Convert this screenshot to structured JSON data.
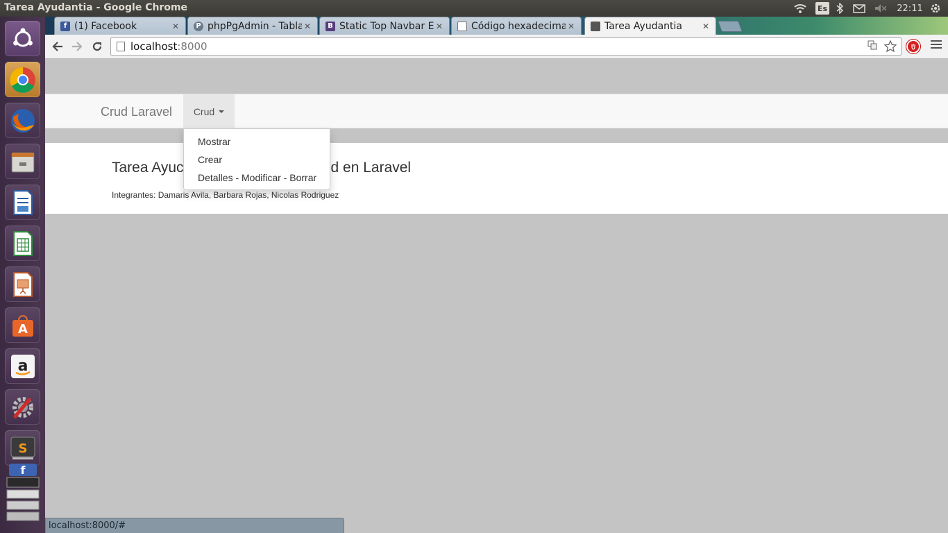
{
  "window": {
    "title": "Tarea Ayudantia - Google Chrome"
  },
  "panel": {
    "keyboard_layout": "Es",
    "clock": "22:11"
  },
  "launcher": {
    "items": [
      {
        "name": "ubuntu-dash-icon"
      },
      {
        "name": "chrome-icon"
      },
      {
        "name": "firefox-icon"
      },
      {
        "name": "files-icon"
      },
      {
        "name": "writer-icon"
      },
      {
        "name": "calc-icon"
      },
      {
        "name": "impress-icon"
      },
      {
        "name": "software-center-icon"
      },
      {
        "name": "amazon-icon"
      },
      {
        "name": "system-settings-icon"
      },
      {
        "name": "sublime-text-icon"
      },
      {
        "name": "workspace-stack-icon"
      }
    ]
  },
  "tabs": [
    {
      "label": "(1) Facebook",
      "favicon": "f",
      "color": "#3b5998"
    },
    {
      "label": "phpPgAdmin - Tablas",
      "favicon": "P",
      "color": "#6b7b8c"
    },
    {
      "label": "Static Top Navbar Exa",
      "favicon": "B",
      "color": "#563d7c"
    },
    {
      "label": "Código hexadecimal c",
      "favicon": "",
      "color": "#ffffff"
    },
    {
      "label": "Tarea Ayudantia",
      "favicon": "",
      "color": "#555555"
    }
  ],
  "address": {
    "host": "localhost",
    "port": ":8000"
  },
  "navbar": {
    "brand": "Crud Laravel",
    "dropdown_label": "Crud"
  },
  "dropdown": {
    "items": [
      "Mostrar",
      "Crear",
      "Detalles - Modificar - Borrar"
    ]
  },
  "jumbotron": {
    "heading_left": "Tarea Ayuc",
    "heading_right": "d en Laravel",
    "members": "Integrantes: Damaris Avila, Barbara Rojas, Nicolas Rodriguez"
  },
  "status_bar": {
    "url": "localhost:8000/#"
  }
}
